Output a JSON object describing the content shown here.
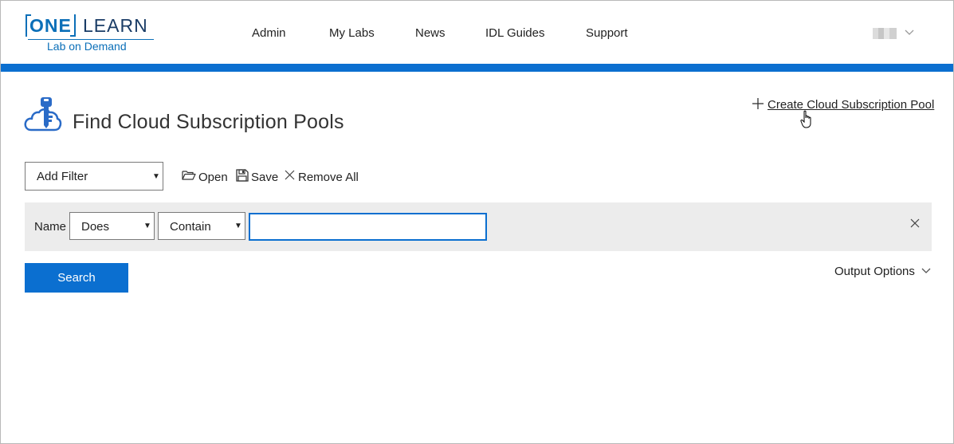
{
  "logo": {
    "one": "ONE",
    "learn": "LEARN",
    "subtitle": "Lab on Demand"
  },
  "nav": {
    "items": [
      "Admin",
      "My Labs",
      "News",
      "IDL Guides",
      "Support"
    ]
  },
  "user": {
    "avatar_icon": "user-avatar",
    "menu_icon": "chevron-down-icon"
  },
  "page": {
    "title": "Find Cloud Subscription Pools",
    "create_link": "Create Cloud Subscription Pool"
  },
  "toolbar": {
    "add_filter": "Add Filter",
    "open": "Open",
    "save": "Save",
    "remove_all": "Remove All"
  },
  "filter_row": {
    "field_label": "Name",
    "operator_1": "Does",
    "operator_2": "Contain",
    "value": ""
  },
  "actions": {
    "search": "Search",
    "output_options": "Output Options"
  },
  "colors": {
    "brand_blue": "#0b6fd0",
    "logo_blue": "#0b6fb8",
    "filter_bg": "#ececec"
  }
}
